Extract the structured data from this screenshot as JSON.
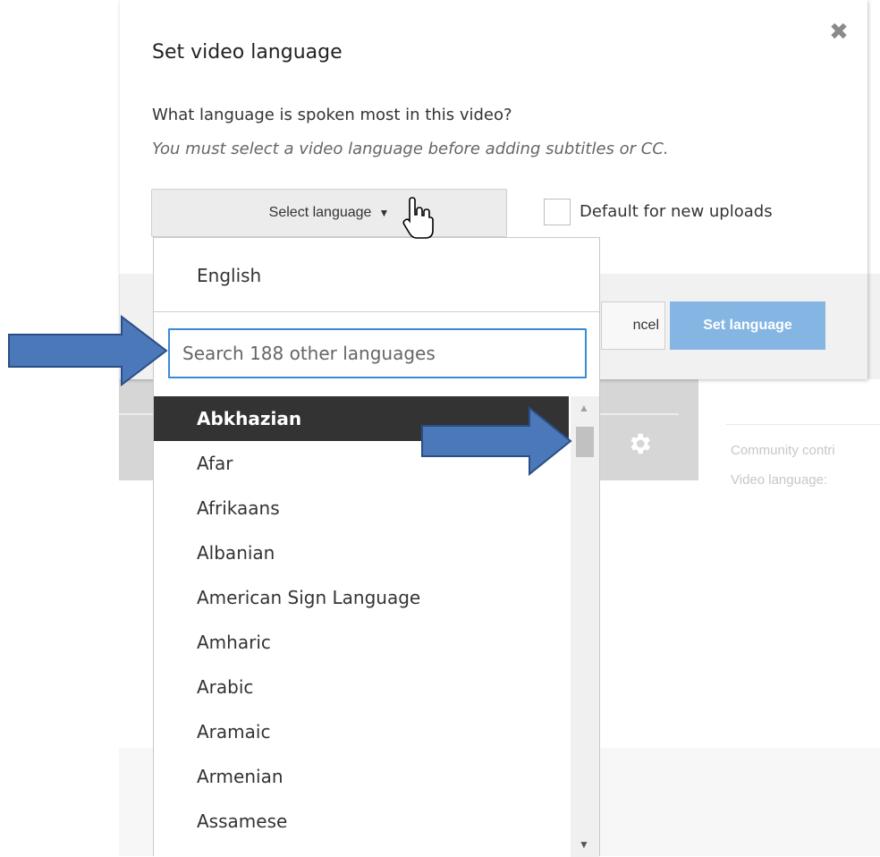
{
  "dialog": {
    "title": "Set video language",
    "question": "What language is spoken most in this video?",
    "hint": "You must select a video language before adding subtitles or CC.",
    "select_button_label": "Select language",
    "checkbox_label": "Default for new uploads",
    "cancel_label": "ncel",
    "set_language_label": "Set language"
  },
  "dropdown": {
    "current_language": "English",
    "search_placeholder": "Search 188 other languages",
    "languages": [
      "Abkhazian",
      "Afar",
      "Afrikaans",
      "Albanian",
      "American Sign Language",
      "Amharic",
      "Arabic",
      "Aramaic",
      "Armenian",
      "Assamese"
    ],
    "selected_index": 0
  },
  "background": {
    "side_text_1": "Community contri",
    "side_text_2": "Video language:"
  },
  "colors": {
    "accent": "#3b8ad8",
    "primary_button": "#85b6e3",
    "selected_item_bg": "#333333",
    "annotation_arrow": "#4a78b8"
  },
  "icons": {
    "close": "close-icon",
    "caret": "caret-down-icon",
    "gear": "gear-icon",
    "cursor": "hand-pointer-icon",
    "annotation": "arrow-right-icon"
  }
}
